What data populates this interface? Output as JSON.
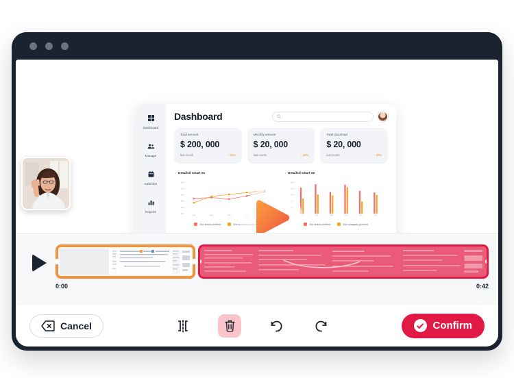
{
  "window": {
    "dots": [
      "red-dot",
      "yellow-dot",
      "green-dot"
    ]
  },
  "app": {
    "title": "Dashboard",
    "search": {
      "placeholder": ""
    },
    "sidebar": {
      "items": [
        {
          "label": "Dashboard",
          "icon": "grid-icon"
        },
        {
          "label": "Manage",
          "icon": "users-icon"
        },
        {
          "label": "Calendar",
          "icon": "calendar-icon"
        },
        {
          "label": "Reports",
          "icon": "bar-chart-icon"
        }
      ]
    },
    "cards": [
      {
        "label": "Total amount",
        "value": "$ 200, 000",
        "foot_left": "last month",
        "foot_right": "↑ 30%"
      },
      {
        "label": "Monthly amount",
        "value": "$ 20, 000",
        "foot_left": "last month",
        "foot_right": "↑ 30%"
      },
      {
        "label": "Total download",
        "value": "$ 20, 000",
        "foot_left": "last month",
        "foot_right": "↑ 30%"
      }
    ],
    "legend": [
      {
        "label": "The brand product",
        "color": "#f4706a"
      },
      {
        "label": "The company product",
        "color": "#f5a623"
      }
    ]
  },
  "chart_data": [
    {
      "type": "line",
      "title": "Detailed Chart 01",
      "categories": [
        "FEB",
        "MAR",
        "APR",
        "MAY",
        "JUN"
      ],
      "yticks": [
        "1000",
        "2000",
        "3000",
        "4000",
        "5000",
        "6000"
      ],
      "ylim": [
        0,
        6000
      ],
      "grid": true,
      "legend_position": "bottom",
      "series": [
        {
          "name": "The brand product",
          "color": "#f4706a",
          "values": [
            2900,
            3100,
            2800,
            3400,
            4200
          ]
        },
        {
          "name": "The company product",
          "color": "#f5a623",
          "values": [
            2100,
            3300,
            3700,
            4100,
            4400
          ]
        }
      ]
    },
    {
      "type": "bar",
      "title": "Detailed Chart 02",
      "categories": [
        "JAN",
        "FEB",
        "MAR",
        "APR",
        "MAY",
        "JUN"
      ],
      "yticks": [
        "1000",
        "2000",
        "3000",
        "4000",
        "5000",
        "6000"
      ],
      "ylim": [
        0,
        6000
      ],
      "grid": true,
      "legend_position": "bottom",
      "series": [
        {
          "name": "The brand product",
          "color": "#f4706a",
          "values": [
            5000,
            5700,
            4200,
            5600,
            4400,
            4100
          ]
        },
        {
          "name": "The company product",
          "color": "#f5a623",
          "values": [
            2900,
            3700,
            3500,
            5100,
            2300,
            3600
          ]
        }
      ]
    }
  ],
  "preview": {
    "play_icon": "play-icon",
    "webcam": "presenter-video-thumbnail"
  },
  "timeline": {
    "play_icon": "play-icon",
    "start_time": "0:00",
    "end_time": "0:42",
    "clips": [
      {
        "name": "selected-clip",
        "state": "selected",
        "accent": "#f5903a"
      },
      {
        "name": "trimmed-clip",
        "state": "trimmed",
        "accent": "#e01a45"
      }
    ]
  },
  "toolbar": {
    "cancel_label": "Cancel",
    "cancel_icon": "backspace-icon",
    "split_icon": "split-icon",
    "delete_icon": "trash-icon",
    "undo_icon": "undo-icon",
    "redo_icon": "redo-icon",
    "confirm_label": "Confirm",
    "confirm_icon": "check-circle-icon"
  },
  "colors": {
    "accent_red": "#e01a45",
    "accent_orange": "#f5903a",
    "titlebar": "#1b2230",
    "trash_bg": "#f9c4cb"
  }
}
